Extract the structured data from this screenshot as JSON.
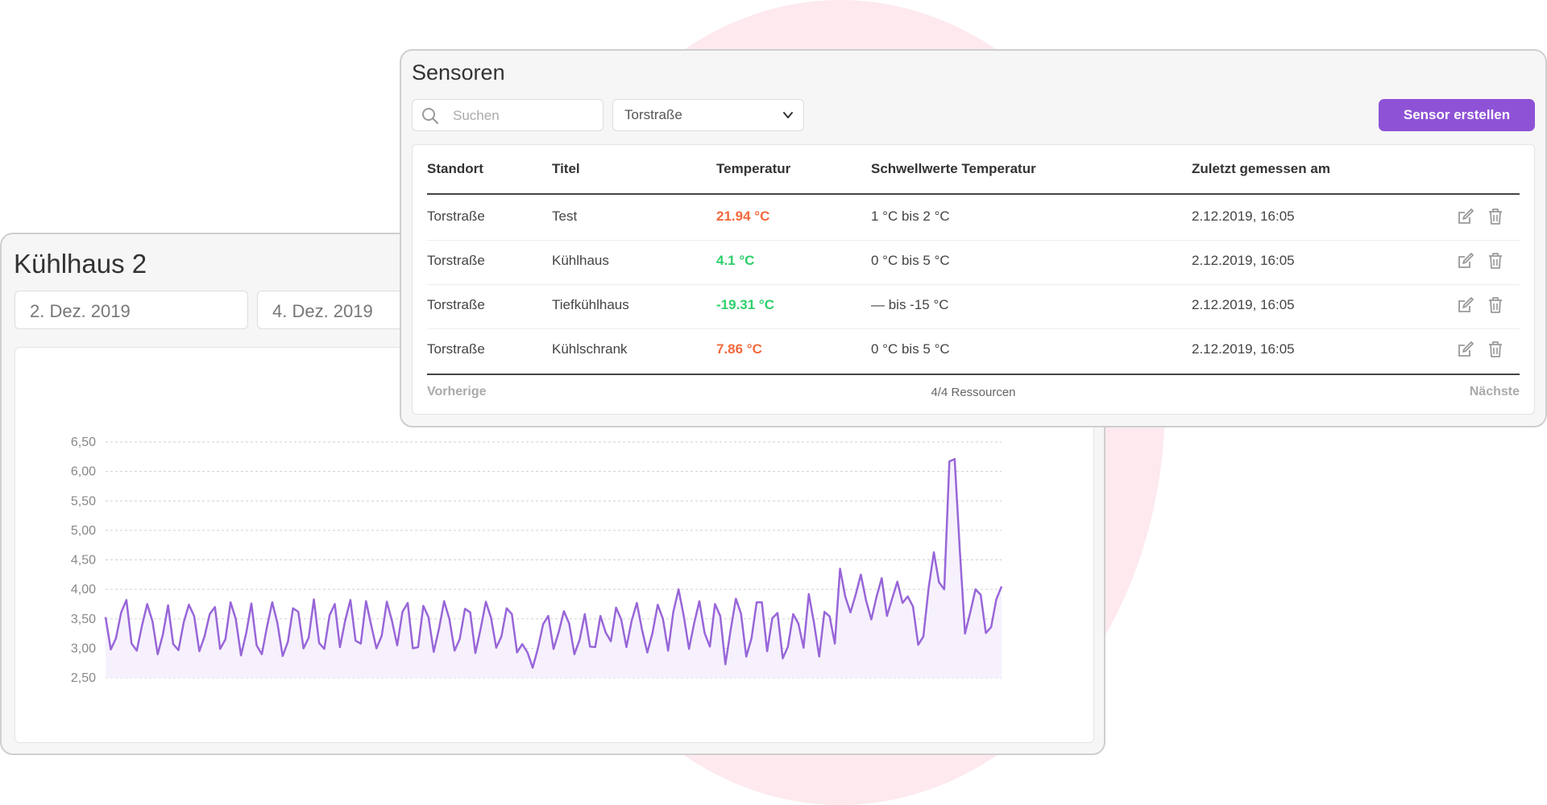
{
  "kuehlhaus": {
    "title": "Kühlhaus 2",
    "date_from": "2. Dez. 2019",
    "date_to": "4. Dez. 2019"
  },
  "sensoren": {
    "title": "Sensoren",
    "search_placeholder": "Suchen",
    "location_select": "Torstraße",
    "create_button": "Sensor erstellen",
    "columns": [
      "Standort",
      "Titel",
      "Temperatur",
      "Schwellwerte Temperatur",
      "Zuletzt gemessen am"
    ],
    "rows": [
      {
        "standort": "Torstraße",
        "titel": "Test",
        "temperatur": "21.94 °C",
        "status": "hot",
        "schwellwerte": "1 °C bis 2 °C",
        "zuletzt": "2.12.2019, 16:05"
      },
      {
        "standort": "Torstraße",
        "titel": "Kühlhaus",
        "temperatur": "4.1 °C",
        "status": "ok",
        "schwellwerte": "0 °C bis 5 °C",
        "zuletzt": "2.12.2019, 16:05"
      },
      {
        "standort": "Torstraße",
        "titel": "Tiefkühlhaus",
        "temperatur": "-19.31 °C",
        "status": "ok",
        "schwellwerte": "— bis -15 °C",
        "zuletzt": "2.12.2019, 16:05"
      },
      {
        "standort": "Torstraße",
        "titel": "Kühlschrank",
        "temperatur": "7.86 °C",
        "status": "hot",
        "schwellwerte": "0 °C bis 5 °C",
        "zuletzt": "2.12.2019, 16:05"
      }
    ],
    "pagination": {
      "previous": "Vorherige",
      "count": "4/4 Ressourcen",
      "next": "Nächste"
    }
  },
  "colors": {
    "accent": "#8e52d6",
    "hot": "#f2693d",
    "ok": "#2fcf6b",
    "line": "#9866d8",
    "area": "#f6f1fd"
  },
  "icons": {
    "search": "search-icon",
    "chevron": "chevron-down-icon",
    "edit": "edit-icon",
    "delete": "trash-icon"
  },
  "chart_data": {
    "type": "line",
    "title": "",
    "xlabel": "",
    "ylabel": "",
    "ylim": [
      2.5,
      6.5
    ],
    "yticks": [
      "6,50",
      "6,00",
      "5,50",
      "5,00",
      "4,50",
      "4,00",
      "3,50",
      "3,00",
      "2,50"
    ],
    "grid": true,
    "series": [
      {
        "values": [
          3.53,
          2.98,
          3.17,
          3.61,
          3.82,
          3.08,
          2.96,
          3.39,
          3.75,
          3.46,
          2.9,
          3.23,
          3.73,
          3.07,
          2.97,
          3.44,
          3.74,
          3.55,
          2.95,
          3.2,
          3.58,
          3.7,
          2.99,
          3.15,
          3.78,
          3.5,
          2.88,
          3.26,
          3.76,
          3.05,
          2.9,
          3.37,
          3.78,
          3.43,
          2.87,
          3.11,
          3.68,
          3.62,
          3.0,
          3.18,
          3.83,
          3.09,
          2.99,
          3.56,
          3.75,
          3.02,
          3.47,
          3.82,
          3.13,
          3.08,
          3.8,
          3.39,
          3.0,
          3.21,
          3.79,
          3.46,
          3.05,
          3.62,
          3.77,
          3.0,
          3.02,
          3.72,
          3.53,
          2.94,
          3.33,
          3.8,
          3.5,
          2.96,
          3.16,
          3.67,
          3.61,
          2.92,
          3.33,
          3.79,
          3.52,
          3.01,
          3.2,
          3.68,
          3.58,
          2.93,
          3.07,
          2.93,
          2.67,
          3.0,
          3.41,
          3.55,
          2.99,
          3.28,
          3.63,
          3.42,
          2.9,
          3.14,
          3.58,
          3.03,
          3.02,
          3.55,
          3.27,
          3.12,
          3.69,
          3.49,
          3.02,
          3.47,
          3.77,
          3.31,
          2.93,
          3.26,
          3.74,
          3.5,
          2.96,
          3.62,
          4.0,
          3.55,
          2.99,
          3.43,
          3.8,
          3.26,
          3.03,
          3.75,
          3.55,
          2.73,
          3.31,
          3.84,
          3.59,
          2.86,
          3.17,
          3.78,
          3.78,
          2.95,
          3.51,
          3.6,
          2.83,
          3.03,
          3.58,
          3.42,
          3.01,
          3.92,
          3.43,
          2.86,
          3.62,
          3.54,
          3.08,
          4.35,
          3.88,
          3.61,
          3.91,
          4.25,
          3.81,
          3.49,
          3.87,
          4.19,
          3.55,
          3.84,
          4.13,
          3.77,
          3.88,
          3.71,
          3.06,
          3.2,
          4.02,
          4.63,
          4.12,
          4.0,
          6.17,
          6.21,
          4.65,
          3.25,
          3.61,
          4.0,
          3.91,
          3.26,
          3.36,
          3.83,
          4.05
        ]
      }
    ]
  }
}
